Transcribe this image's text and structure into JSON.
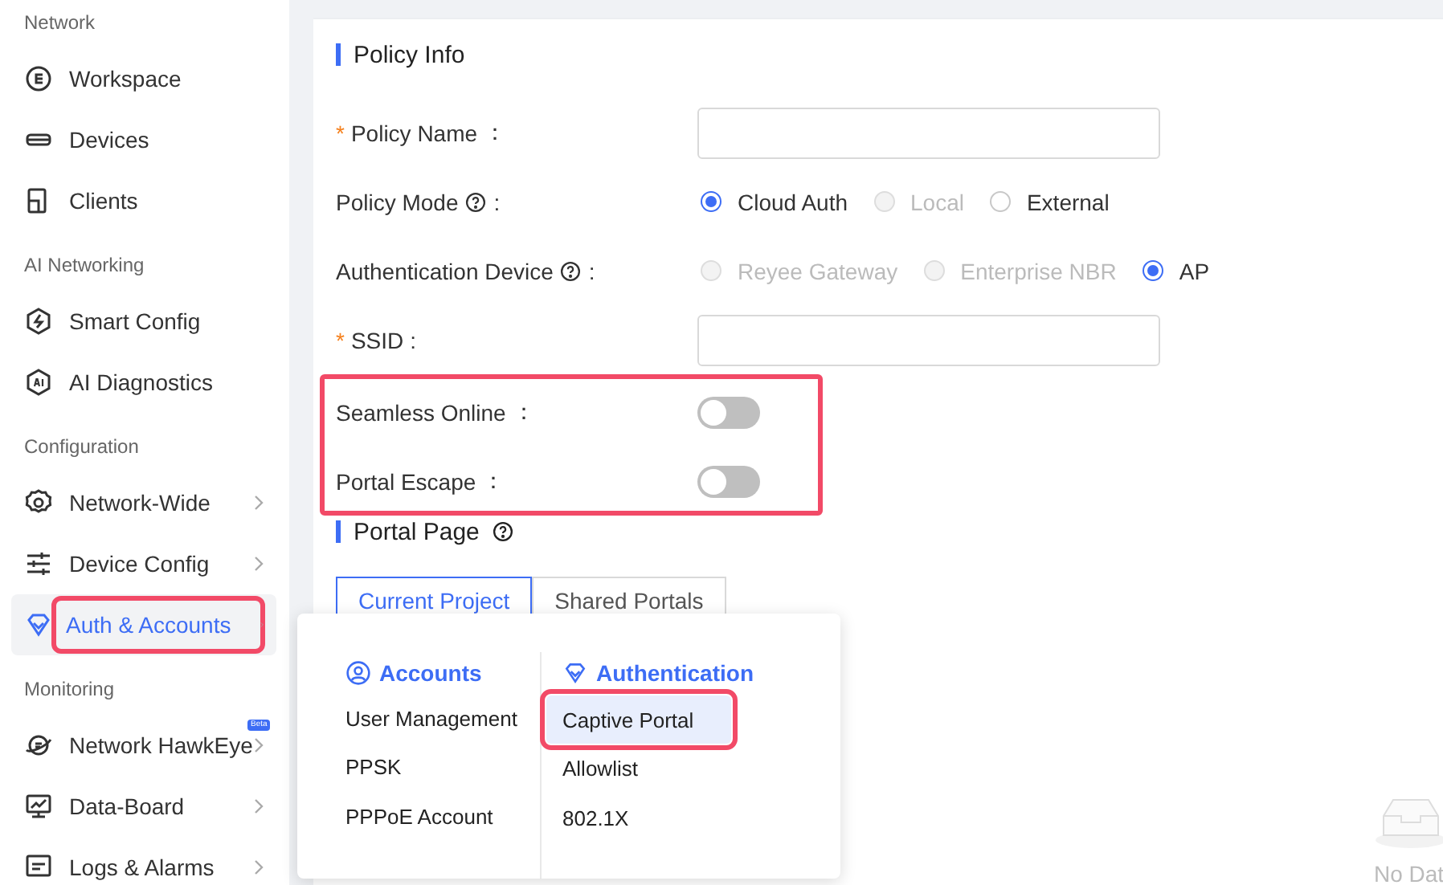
{
  "sidebar": {
    "sections": [
      {
        "title": "Network",
        "items": [
          {
            "label": "Workspace",
            "has_submenu": false,
            "selected": false,
            "highlighted": false
          },
          {
            "label": "Devices",
            "has_submenu": false,
            "selected": false,
            "highlighted": false
          },
          {
            "label": "Clients",
            "has_submenu": false,
            "selected": false,
            "highlighted": false
          }
        ]
      },
      {
        "title": "AI Networking",
        "items": [
          {
            "label": "Smart Config",
            "has_submenu": false,
            "selected": false,
            "highlighted": false
          },
          {
            "label": "AI Diagnostics",
            "has_submenu": false,
            "selected": false,
            "highlighted": false
          }
        ]
      },
      {
        "title": "Configuration",
        "items": [
          {
            "label": "Network-Wide",
            "has_submenu": true,
            "selected": false,
            "highlighted": false
          },
          {
            "label": "Device Config",
            "has_submenu": true,
            "selected": false,
            "highlighted": false
          },
          {
            "label": "Auth & Accounts",
            "has_submenu": true,
            "selected": true,
            "highlighted": true
          }
        ]
      },
      {
        "title": "Monitoring",
        "items": [
          {
            "label": "Network HawkEye",
            "has_submenu": true,
            "selected": false,
            "highlighted": false,
            "badge": "Beta"
          },
          {
            "label": "Data-Board",
            "has_submenu": true,
            "selected": false,
            "highlighted": false
          },
          {
            "label": "Logs & Alarms",
            "has_submenu": true,
            "selected": false,
            "highlighted": false
          }
        ]
      }
    ]
  },
  "policy_info": {
    "title": "Policy Info",
    "rows": [
      {
        "kind": "input",
        "label": "Policy Name",
        "suffix": "：",
        "required_mark": "*",
        "help": false
      },
      {
        "kind": "radio",
        "label": "Policy Mode",
        "suffix": ":",
        "help": true,
        "options": [
          {
            "label": "Cloud Auth",
            "selected": true,
            "disabled": false
          },
          {
            "label": "Local",
            "selected": false,
            "disabled": true
          },
          {
            "label": "External",
            "selected": false,
            "disabled": false
          }
        ]
      },
      {
        "kind": "radio",
        "label": "Authentication Device",
        "suffix": ":",
        "help": true,
        "options": [
          {
            "label": "Reyee Gateway",
            "selected": false,
            "disabled": true
          },
          {
            "label": "Enterprise NBR",
            "selected": false,
            "disabled": true
          },
          {
            "label": "AP",
            "selected": true,
            "disabled": false
          }
        ]
      },
      {
        "kind": "input",
        "label": "SSID",
        "suffix": ":",
        "required_mark": "*",
        "help": false
      }
    ],
    "switch_group": {
      "highlighted": true,
      "rows": [
        {
          "label": "Seamless Online",
          "suffix": "：",
          "on": false
        },
        {
          "label": "Portal Escape",
          "suffix": "：",
          "on": false
        }
      ]
    }
  },
  "portal_page": {
    "title": "Portal Page",
    "help": true,
    "tabs": [
      {
        "label": "Current Project",
        "selected": true
      },
      {
        "label": "Shared Portals",
        "selected": false
      }
    ],
    "empty_text": "No Dat"
  },
  "submenu": {
    "columns": [
      {
        "title": "Accounts",
        "items": [
          {
            "label": "User Management",
            "selected": false,
            "highlighted": false
          },
          {
            "label": "PPSK",
            "selected": false,
            "highlighted": false
          },
          {
            "label": "PPPoE Account",
            "selected": false,
            "highlighted": false
          }
        ]
      },
      {
        "title": "Authentication",
        "items": [
          {
            "label": "Captive Portal",
            "selected": true,
            "highlighted": true
          },
          {
            "label": "Allowlist",
            "selected": false,
            "highlighted": false
          },
          {
            "label": "802.1X",
            "selected": false,
            "highlighted": false
          }
        ]
      }
    ]
  }
}
